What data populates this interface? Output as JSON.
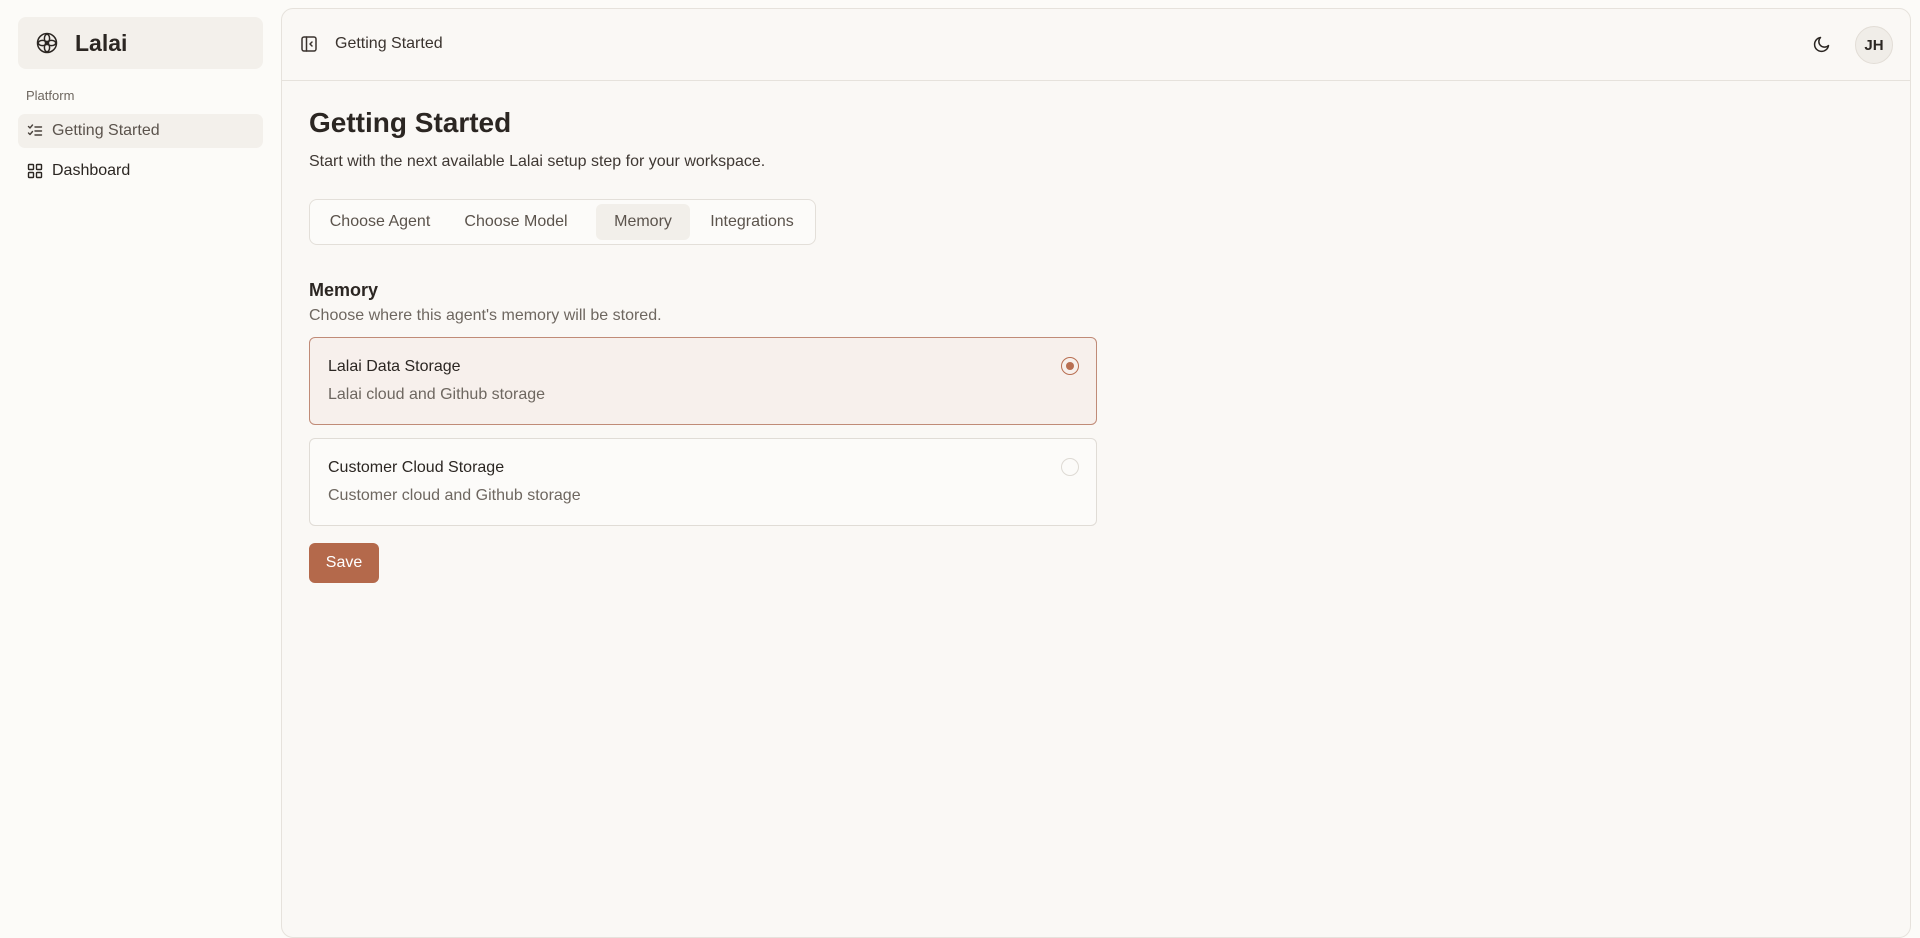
{
  "app": {
    "name": "Lalai",
    "logo_icon": "flower-icon"
  },
  "sidebar": {
    "section_label": "Platform",
    "items": [
      {
        "label": "Getting Started",
        "icon": "checklist-icon",
        "active": true
      },
      {
        "label": "Dashboard",
        "icon": "grid-icon",
        "active": false
      }
    ]
  },
  "header": {
    "breadcrumb": "Getting Started",
    "avatar_initials": "JH",
    "toggle_icon": "sidebar-toggle-icon",
    "theme_icon": "moon-icon"
  },
  "page": {
    "title": "Getting Started",
    "subtitle": "Start with the next available Lalai setup step for your workspace."
  },
  "tabs": [
    {
      "label": "Choose Agent",
      "active": false
    },
    {
      "label": "Choose Model",
      "active": false
    },
    {
      "label": "Memory",
      "active": true
    },
    {
      "label": "Integrations",
      "active": false
    }
  ],
  "memory": {
    "title": "Memory",
    "subtitle": "Choose where this agent's memory will be stored.",
    "options": [
      {
        "title": "Lalai Data Storage",
        "description": "Lalai cloud and Github storage",
        "selected": true
      },
      {
        "title": "Customer Cloud Storage",
        "description": "Customer cloud and Github storage",
        "selected": false
      }
    ],
    "save_label": "Save"
  },
  "colors": {
    "accent": "#b4694b",
    "selected_border": "#c08b77",
    "selected_bg": "#f7f0ec",
    "background": "#fcfbf8"
  }
}
